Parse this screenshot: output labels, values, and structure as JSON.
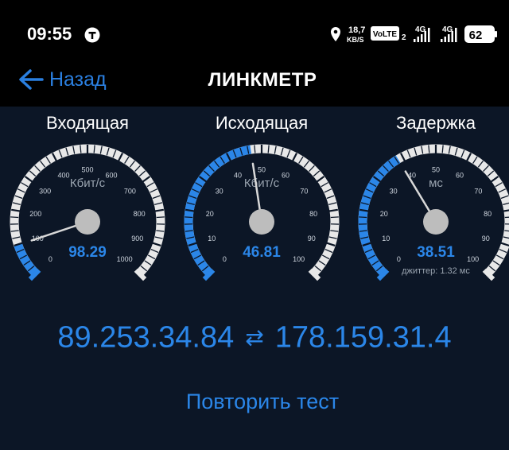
{
  "status_bar": {
    "time": "09:55",
    "net_speed_value": "18,7",
    "net_speed_unit": "KB/S",
    "volte": "VoLTE",
    "sim_index": "2",
    "sig1": "4G",
    "sig2": "4G",
    "battery": "62",
    "colors": {
      "background": "#000000",
      "text": "#ffffff"
    }
  },
  "app_bar": {
    "back_label": "Назад",
    "title": "ЛИНКМЕТР"
  },
  "gauges": [
    {
      "title": "Входящая",
      "unit": "Кбит/с",
      "value": 98.29,
      "value_text": "98.29",
      "scale_max": 1000,
      "tick_labels": [
        "0",
        "100",
        "200",
        "300",
        "400",
        "500",
        "600",
        "700",
        "800",
        "900",
        "1000"
      ],
      "extra": ""
    },
    {
      "title": "Исходящая",
      "unit": "Кбит/с",
      "value": 46.81,
      "value_text": "46.81",
      "scale_max": 100,
      "tick_labels": [
        "0",
        "10",
        "20",
        "30",
        "40",
        "50",
        "60",
        "70",
        "80",
        "90",
        "100"
      ],
      "extra": ""
    },
    {
      "title": "Задержка",
      "unit": "мс",
      "value": 38.51,
      "value_text": "38.51",
      "scale_max": 100,
      "tick_labels": [
        "0",
        "10",
        "20",
        "30",
        "40",
        "50",
        "60",
        "70",
        "80",
        "90",
        "100"
      ],
      "extra": "джиттер: 1.32 мс"
    }
  ],
  "connection": {
    "local_ip": "89.253.34.84",
    "arrow": "⇄",
    "remote_ip": "178.159.31.4"
  },
  "retry_label": "Повторить тест",
  "colors": {
    "accent": "#2b86e8",
    "background": "#0c1626",
    "gauge_track": "#e8e8e8",
    "tick_label": "#cfd6df",
    "unit_label": "#9aa4b0",
    "hub": "#bdbdbd"
  }
}
